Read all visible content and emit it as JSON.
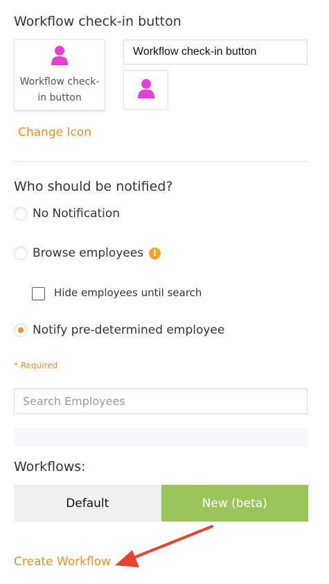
{
  "button_settings": {
    "title": "Workflow check-in button",
    "preview_label": "Workflow check-in button",
    "name_value": "Workflow check-in button",
    "change_icon_label": "Change Icon",
    "icon": "person-icon",
    "icon_color": "#e53fd6"
  },
  "notification": {
    "heading": "Who should be notified?",
    "options": [
      {
        "label": "No Notification",
        "selected": false
      },
      {
        "label": "Browse employees",
        "selected": false
      },
      {
        "label": "Notify pre-determined employee",
        "selected": true
      }
    ],
    "hide_employees_label": "Hide employees until search",
    "hide_employees_checked": false,
    "required_label": "* Required",
    "search_placeholder": "Search Employees",
    "search_value": ""
  },
  "workflows": {
    "heading": "Workflows:",
    "tabs": [
      {
        "label": "Default",
        "active": false
      },
      {
        "label": "New (beta)",
        "active": true
      }
    ],
    "create_label": "Create Workflow"
  },
  "colors": {
    "accent": "#ec8f2a",
    "active_tab": "#99c55a",
    "annotation_arrow": "#e8432d"
  }
}
